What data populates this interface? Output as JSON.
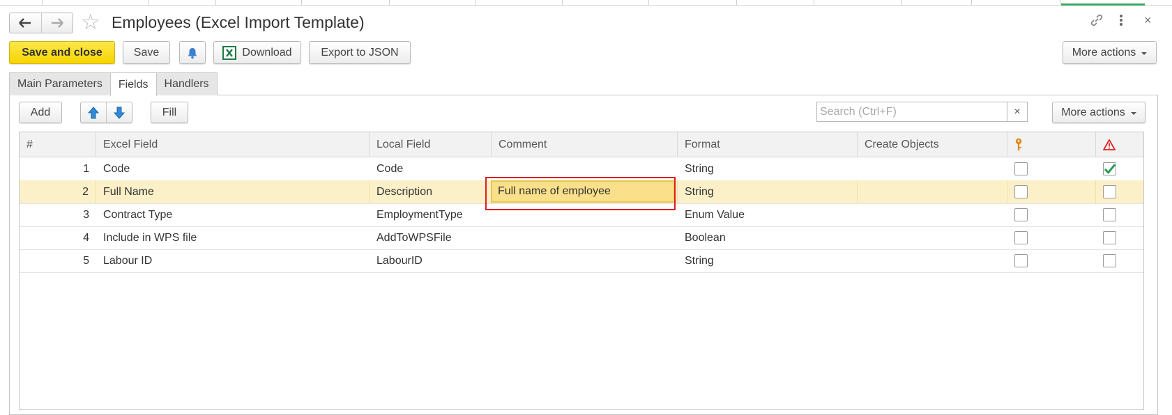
{
  "window": {
    "title": "Employees (Excel Import Template)",
    "back_icon": "arrow-left-icon",
    "forward_icon": "arrow-right-icon",
    "favorite_icon": "star-icon",
    "link_icon": "link-icon",
    "menu_icon": "vertical-dots-icon",
    "close_glyph": "×"
  },
  "toolbar": {
    "save_and_close": "Save and close",
    "save": "Save",
    "bell_icon": "bell-icon",
    "download": "Download",
    "download_icon": "excel-icon",
    "export_json": "Export to JSON",
    "more_actions": "More actions"
  },
  "tabs": [
    {
      "label": "Main Parameters",
      "active": false
    },
    {
      "label": "Fields",
      "active": true
    },
    {
      "label": "Handlers",
      "active": false
    }
  ],
  "fields_toolbar": {
    "add": "Add",
    "move_up_icon": "arrow-up-icon",
    "move_down_icon": "arrow-down-icon",
    "fill": "Fill",
    "search_placeholder": "Search (Ctrl+F)",
    "search_clear": "×",
    "more_actions": "More actions"
  },
  "table": {
    "columns": {
      "num": "#",
      "excel_field": "Excel Field",
      "local_field": "Local Field",
      "comment": "Comment",
      "format": "Format",
      "create_objects": "Create Objects",
      "key_icon": "key-icon",
      "warning_icon": "warning-icon"
    },
    "rows": [
      {
        "num": "1",
        "excel_field": "Code",
        "local_field": "Code",
        "comment": "",
        "format": "String",
        "create_objects": "",
        "key": false,
        "required": true
      },
      {
        "num": "2",
        "excel_field": "Full Name",
        "local_field": "Description",
        "comment": "Full name of employee",
        "format": "String",
        "create_objects": "",
        "key": false,
        "required": false
      },
      {
        "num": "3",
        "excel_field": "Contract Type",
        "local_field": "EmploymentType",
        "comment": "",
        "format": "Enum Value",
        "create_objects": "",
        "key": false,
        "required": false
      },
      {
        "num": "4",
        "excel_field": "Include in WPS file",
        "local_field": "AddToWPSFile",
        "comment": "",
        "format": "Boolean",
        "create_objects": "",
        "key": false,
        "required": false
      },
      {
        "num": "5",
        "excel_field": "Labour ID",
        "local_field": "LabourID",
        "comment": "",
        "format": "String",
        "create_objects": "",
        "key": false,
        "required": false
      }
    ],
    "selected_row": 1
  },
  "colors": {
    "primary_button": "#f5d400",
    "selected_row": "#fbf0c8",
    "edit_cell": "#fae08a",
    "highlight_border": "#e11c1c",
    "check": "#1a9a4a"
  }
}
